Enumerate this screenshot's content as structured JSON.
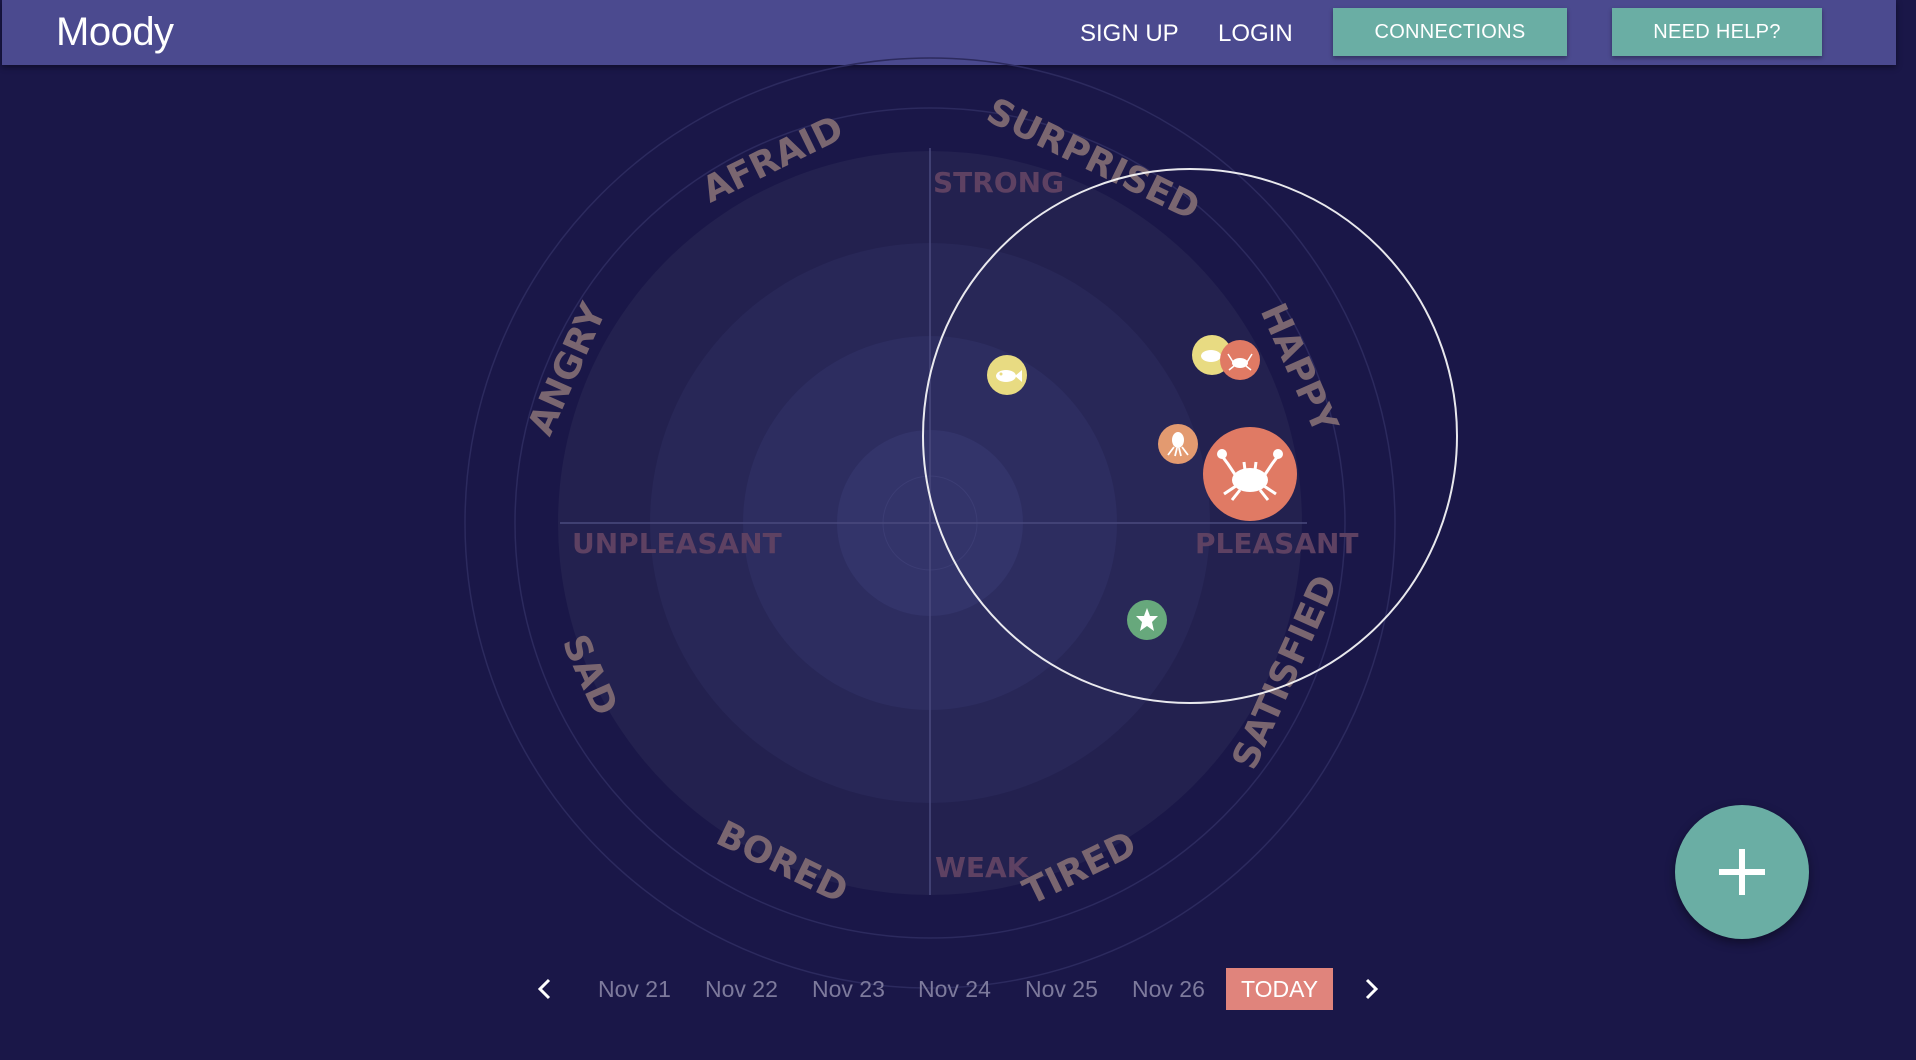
{
  "app": {
    "name": "Moody"
  },
  "nav": {
    "signup_label": "SIGN UP",
    "login_label": "LOGIN",
    "connections_label": "CONNECTIONS",
    "help_label": "NEED HELP?"
  },
  "radar": {
    "axis_labels": {
      "strong": "STRONG",
      "weak": "WEAK",
      "unpleasant": "UNPLEASANT",
      "pleasant": "PLEASANT"
    },
    "emotions": {
      "afraid": "AFRAID",
      "surprised": "SURPRISED",
      "angry": "ANGRY",
      "happy": "HAPPY",
      "sad": "SAD",
      "satisfied": "SATISFIED",
      "bored": "BORED",
      "tired": "TIRED"
    },
    "mood_markers": [
      {
        "icon": "fish-icon",
        "color": "#e8db82"
      },
      {
        "icon": "fish-icon",
        "color": "#e8db82"
      },
      {
        "icon": "crab-icon",
        "color": "#e07a64"
      },
      {
        "icon": "octopus-icon",
        "color": "#e39a70"
      },
      {
        "icon": "crab-icon",
        "color": "#e07a64"
      },
      {
        "icon": "starfish-icon",
        "color": "#67a87c"
      }
    ]
  },
  "timeline": {
    "dates": [
      "Nov 21",
      "Nov 22",
      "Nov 23",
      "Nov 24",
      "Nov 25",
      "Nov 26"
    ],
    "today_label": "TODAY"
  },
  "colors": {
    "background": "#1a1748",
    "navbar": "#4b4a8f",
    "button": "#6aaea4",
    "today": "#e0847c"
  },
  "fab": {
    "icon": "plus-icon"
  }
}
